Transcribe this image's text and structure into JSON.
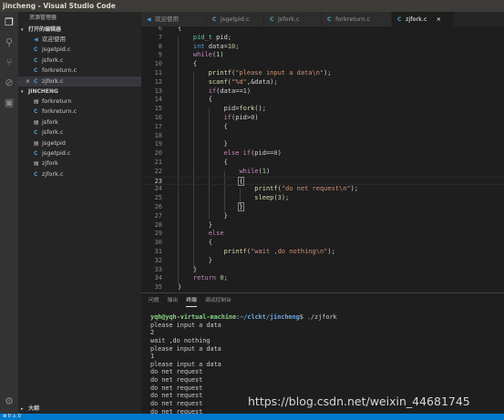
{
  "window": {
    "title": "jincheng - Visual Studio Code"
  },
  "activity_bar": {
    "items": [
      {
        "icon": "files-icon",
        "glyph": "❐"
      },
      {
        "icon": "search-icon",
        "glyph": "⚲"
      },
      {
        "icon": "source-control-icon",
        "glyph": "⑂"
      },
      {
        "icon": "debug-icon",
        "glyph": "⊘"
      },
      {
        "icon": "extensions-icon",
        "glyph": "▣"
      }
    ],
    "settings_glyph": "⚙"
  },
  "sidebar": {
    "title": "资源管理器",
    "open_editors": {
      "header": "打开的编辑器",
      "items": [
        {
          "label": "欢迎使用",
          "icon": "vs"
        },
        {
          "label": "jsgetpid.c",
          "icon": "c"
        },
        {
          "label": "jsfork.c",
          "icon": "c"
        },
        {
          "label": "forkreturn.c",
          "icon": "c"
        },
        {
          "label": "zjfork.c",
          "icon": "c",
          "close": "×"
        }
      ]
    },
    "folder": {
      "header": "JINCHENG",
      "items": [
        {
          "label": "forkreturn",
          "icon": "doc"
        },
        {
          "label": "forkreturn.c",
          "icon": "c"
        },
        {
          "label": "jsfork",
          "icon": "doc"
        },
        {
          "label": "jsfork.c",
          "icon": "c"
        },
        {
          "label": "jsgetpid",
          "icon": "doc"
        },
        {
          "label": "jsgetpid.c",
          "icon": "c"
        },
        {
          "label": "zjfork",
          "icon": "doc"
        },
        {
          "label": "zjfork.c",
          "icon": "c"
        }
      ]
    },
    "outline_header": "大纲"
  },
  "tabs": [
    {
      "label": "欢迎使用",
      "icon": "vs",
      "active": false
    },
    {
      "label": "jsgetpid.c",
      "icon": "c",
      "active": false
    },
    {
      "label": "jsfork.c",
      "icon": "c",
      "active": false
    },
    {
      "label": "forkreturn.c",
      "icon": "c",
      "active": false
    },
    {
      "label": "zjfork.c",
      "icon": "c",
      "active": true,
      "close": "×"
    }
  ],
  "editor": {
    "current_line": 23,
    "lines": [
      {
        "n": "6",
        "segs": [
          [
            "{",
            "p"
          ]
        ]
      },
      {
        "n": "7",
        "segs": [
          [
            "    ",
            "p"
          ],
          [
            "pid_t",
            "type"
          ],
          [
            " pid;",
            "p"
          ]
        ]
      },
      {
        "n": "8",
        "segs": [
          [
            "    ",
            "p"
          ],
          [
            "int",
            "kw"
          ],
          [
            " data=",
            "p"
          ],
          [
            "10",
            "num"
          ],
          [
            ";",
            "p"
          ]
        ]
      },
      {
        "n": "9",
        "segs": [
          [
            "    ",
            "p"
          ],
          [
            "while",
            "ctl"
          ],
          [
            "(",
            "p"
          ],
          [
            "1",
            "num"
          ],
          [
            ")",
            "p"
          ]
        ]
      },
      {
        "n": "10",
        "segs": [
          [
            "    {",
            "p"
          ]
        ]
      },
      {
        "n": "11",
        "segs": [
          [
            "        ",
            "p"
          ],
          [
            "printf",
            "fn"
          ],
          [
            "(",
            "p"
          ],
          [
            "\"please input a data\\n\"",
            "str"
          ],
          [
            ");",
            "p"
          ]
        ]
      },
      {
        "n": "12",
        "segs": [
          [
            "        ",
            "p"
          ],
          [
            "scanf",
            "fn"
          ],
          [
            "(",
            "p"
          ],
          [
            "\"%d\"",
            "str"
          ],
          [
            ",&data);",
            "p"
          ]
        ]
      },
      {
        "n": "13",
        "segs": [
          [
            "        ",
            "p"
          ],
          [
            "if",
            "ctl"
          ],
          [
            "(data==",
            "p"
          ],
          [
            "1",
            "num"
          ],
          [
            ")",
            "p"
          ]
        ]
      },
      {
        "n": "14",
        "segs": [
          [
            "        {",
            "p"
          ]
        ]
      },
      {
        "n": "15",
        "segs": [
          [
            "            pid=",
            "p"
          ],
          [
            "fork",
            "fn"
          ],
          [
            "();",
            "p"
          ]
        ]
      },
      {
        "n": "16",
        "segs": [
          [
            "            ",
            "p"
          ],
          [
            "if",
            "ctl"
          ],
          [
            "(pid>",
            "p"
          ],
          [
            "0",
            "num"
          ],
          [
            ")",
            "p"
          ]
        ]
      },
      {
        "n": "17",
        "segs": [
          [
            "            {",
            "p"
          ]
        ]
      },
      {
        "n": "18",
        "segs": [
          [
            "",
            "p"
          ]
        ]
      },
      {
        "n": "19",
        "segs": [
          [
            "            }",
            "p"
          ]
        ]
      },
      {
        "n": "20",
        "segs": [
          [
            "            ",
            "p"
          ],
          [
            "else",
            "ctl"
          ],
          [
            " ",
            "p"
          ],
          [
            "if",
            "ctl"
          ],
          [
            "(pid==",
            "p"
          ],
          [
            "0",
            "num"
          ],
          [
            ")",
            "p"
          ]
        ]
      },
      {
        "n": "21",
        "segs": [
          [
            "            {",
            "p"
          ]
        ]
      },
      {
        "n": "22",
        "segs": [
          [
            "                ",
            "p"
          ],
          [
            "while",
            "ctl"
          ],
          [
            "(",
            "p"
          ],
          [
            "1",
            "num"
          ],
          [
            ")",
            "p"
          ]
        ]
      },
      {
        "n": "23",
        "segs": [
          [
            "                ",
            "p"
          ],
          [
            "{",
            "bm"
          ]
        ]
      },
      {
        "n": "24",
        "segs": [
          [
            "                    ",
            "p"
          ],
          [
            "printf",
            "fn"
          ],
          [
            "(",
            "p"
          ],
          [
            "\"do net request\\n\"",
            "str"
          ],
          [
            ");",
            "p"
          ]
        ]
      },
      {
        "n": "25",
        "segs": [
          [
            "                    ",
            "p"
          ],
          [
            "sleep",
            "fn"
          ],
          [
            "(",
            "p"
          ],
          [
            "3",
            "num"
          ],
          [
            ");",
            "p"
          ]
        ]
      },
      {
        "n": "26",
        "segs": [
          [
            "                ",
            "p"
          ],
          [
            "}",
            "bm"
          ]
        ]
      },
      {
        "n": "27",
        "segs": [
          [
            "            }",
            "p"
          ]
        ]
      },
      {
        "n": "28",
        "segs": [
          [
            "        }",
            "p"
          ]
        ]
      },
      {
        "n": "29",
        "segs": [
          [
            "        ",
            "p"
          ],
          [
            "else",
            "ctl"
          ]
        ]
      },
      {
        "n": "30",
        "segs": [
          [
            "        {",
            "p"
          ]
        ]
      },
      {
        "n": "31",
        "segs": [
          [
            "            ",
            "p"
          ],
          [
            "printf",
            "fn"
          ],
          [
            "(",
            "p"
          ],
          [
            "\"wait ,do nothing\\n\"",
            "str"
          ],
          [
            ");",
            "p"
          ]
        ]
      },
      {
        "n": "32",
        "segs": [
          [
            "        }",
            "p"
          ]
        ]
      },
      {
        "n": "33",
        "segs": [
          [
            "    }",
            "p"
          ]
        ]
      },
      {
        "n": "34",
        "segs": [
          [
            "    ",
            "p"
          ],
          [
            "return",
            "ctl"
          ],
          [
            " ",
            "p"
          ],
          [
            "0",
            "num"
          ],
          [
            ";",
            "p"
          ]
        ]
      },
      {
        "n": "35",
        "segs": [
          [
            "}",
            "p"
          ]
        ]
      }
    ]
  },
  "syntax_colors": {
    "p": "#d4d4d4",
    "kw": "#569cd6",
    "type": "#4ec9b0",
    "ctl": "#c586c0",
    "fn": "#dcdcaa",
    "str": "#ce9178",
    "num": "#b5cea8",
    "bm": "#d4d4d4"
  },
  "panel": {
    "tabs": [
      {
        "label": "问题",
        "active": false
      },
      {
        "label": "输出",
        "active": false
      },
      {
        "label": "终端",
        "active": true
      },
      {
        "label": "调试控制台",
        "active": false
      }
    ],
    "terminal": {
      "prompt_user": "yqh@yqh-virtual-machine",
      "prompt_path": ":~/clckt/jincheng",
      "prompt_cmd": "$ ./zjfork",
      "output": [
        "please input a data",
        "2",
        "wait ,do nothing",
        "please input a data",
        "1",
        "please input a data",
        "do net request",
        "do net request",
        "do net request",
        "do net request",
        "do net request",
        "do net request"
      ]
    }
  },
  "watermark": "https://blog.csdn.net/weixin_44681745",
  "status_bar": {
    "text": "⊗ 0 ⚠ 0"
  }
}
